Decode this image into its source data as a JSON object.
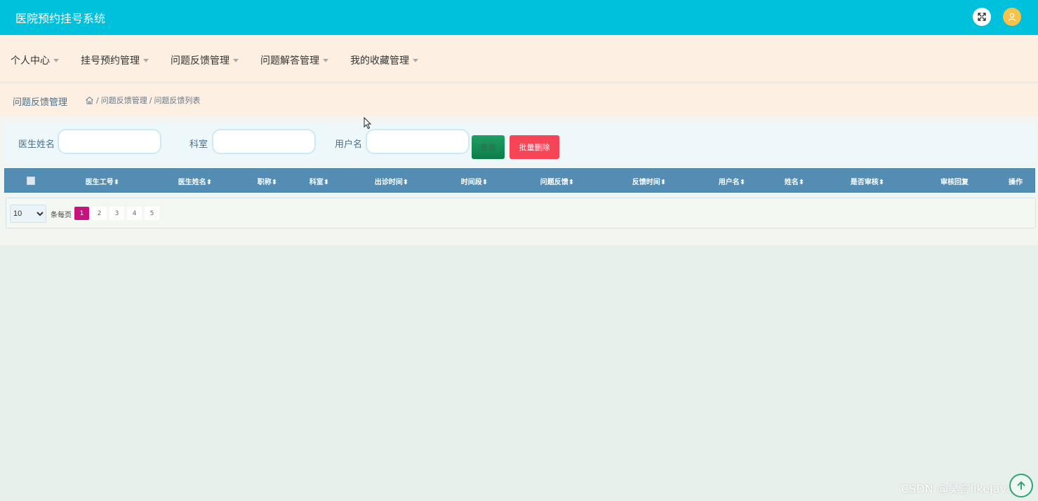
{
  "header": {
    "app_title": "医院预约挂号系统",
    "fullscreen_icon": "fullscreen-icon",
    "avatar_icon": "user-avatar-icon"
  },
  "nav": {
    "items": [
      {
        "label": "个人中心"
      },
      {
        "label": "挂号预约管理"
      },
      {
        "label": "问题反馈管理"
      },
      {
        "label": "问题解答管理"
      },
      {
        "label": "我的收藏管理"
      }
    ]
  },
  "breadcrumb": {
    "page_title": "问题反馈管理",
    "home_icon": "home-icon",
    "separator": "/",
    "path": [
      "问题反馈管理",
      "问题反馈列表"
    ]
  },
  "search": {
    "fields": [
      {
        "label": "医生姓名",
        "value": "",
        "placeholder": ""
      },
      {
        "label": "科室",
        "value": "",
        "placeholder": ""
      },
      {
        "label": "用户名",
        "value": "",
        "placeholder": ""
      }
    ],
    "query_label": "查询",
    "batch_delete_label": "批量删除"
  },
  "table": {
    "columns": [
      "医生工号",
      "医生姓名",
      "职称",
      "科室",
      "出诊时间",
      "时间段",
      "问题反馈",
      "反馈时间",
      "用户名",
      "姓名",
      "是否审核",
      "审核回复",
      "操作"
    ],
    "sort_indicator": "⬍",
    "rows": []
  },
  "pagination": {
    "page_size": "10",
    "page_size_options": [
      "10"
    ],
    "per_page_label": "条每页",
    "pages": [
      "1",
      "2",
      "3",
      "4",
      "5"
    ],
    "current_page": "1"
  },
  "watermark": "CSDN @昊言likeJava",
  "colors": {
    "header_bg": "#00c1dc",
    "menu_bg": "#fdf0e2",
    "table_head_bg": "#538db4",
    "query_button": "#0d7c4a",
    "delete_button": "#f74558",
    "active_page": "#c8137f"
  }
}
